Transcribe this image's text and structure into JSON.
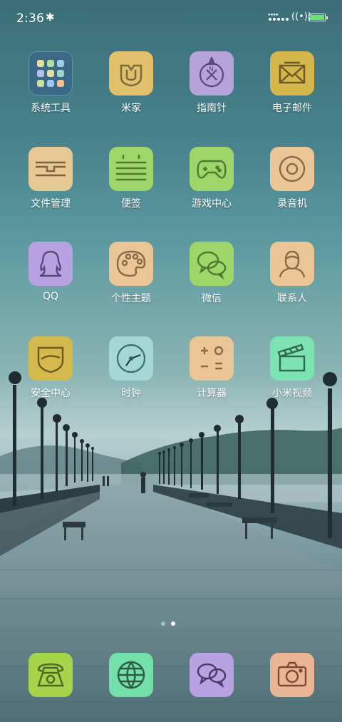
{
  "status_bar": {
    "time": "2:36",
    "bluetooth_icon": "bluetooth-icon",
    "signal_text": "NNNN\nNNNN",
    "wifi_icon": "wifi-icon",
    "battery_level": 1.0,
    "battery_color": "#67e26a"
  },
  "apps": [
    {
      "label": "系统工具",
      "icon": "folder-grid-icon",
      "color": "#3c6a86"
    },
    {
      "label": "米家",
      "icon": "mijia-icon",
      "color": "#e2bf6b"
    },
    {
      "label": "指南针",
      "icon": "compass-icon",
      "color": "#b6a3dc"
    },
    {
      "label": "电子邮件",
      "icon": "mail-icon",
      "color": "#d5b64a"
    },
    {
      "label": "文件管理",
      "icon": "folder-icon",
      "color": "#e6c892"
    },
    {
      "label": "便签",
      "icon": "notes-icon",
      "color": "#9fd66a"
    },
    {
      "label": "游戏中心",
      "icon": "gamepad-icon",
      "color": "#9fd66a"
    },
    {
      "label": "录音机",
      "icon": "recorder-icon",
      "color": "#eac596"
    },
    {
      "label": "QQ",
      "icon": "qq-icon",
      "color": "#b8a2e1"
    },
    {
      "label": "个性主题",
      "icon": "palette-icon",
      "color": "#eac596"
    },
    {
      "label": "微信",
      "icon": "wechat-icon",
      "color": "#9fd66a"
    },
    {
      "label": "联系人",
      "icon": "contact-icon",
      "color": "#eac596"
    },
    {
      "label": "安全中心",
      "icon": "shield-icon",
      "color": "#d4b94c"
    },
    {
      "label": "时钟",
      "icon": "clock-icon",
      "color": "#a3d8d6"
    },
    {
      "label": "计算器",
      "icon": "calculator-icon",
      "color": "#eac596"
    },
    {
      "label": "小米视频",
      "icon": "clapperboard-icon",
      "color": "#7de3b2"
    }
  ],
  "page_indicator": {
    "pages": 2,
    "current": 2
  },
  "dock": [
    {
      "icon": "phone-icon",
      "color": "#a6d54a"
    },
    {
      "icon": "browser-icon",
      "color": "#72e0a8"
    },
    {
      "icon": "messages-icon",
      "color": "#b8a2e1"
    },
    {
      "icon": "camera-icon",
      "color": "#eab595"
    }
  ]
}
